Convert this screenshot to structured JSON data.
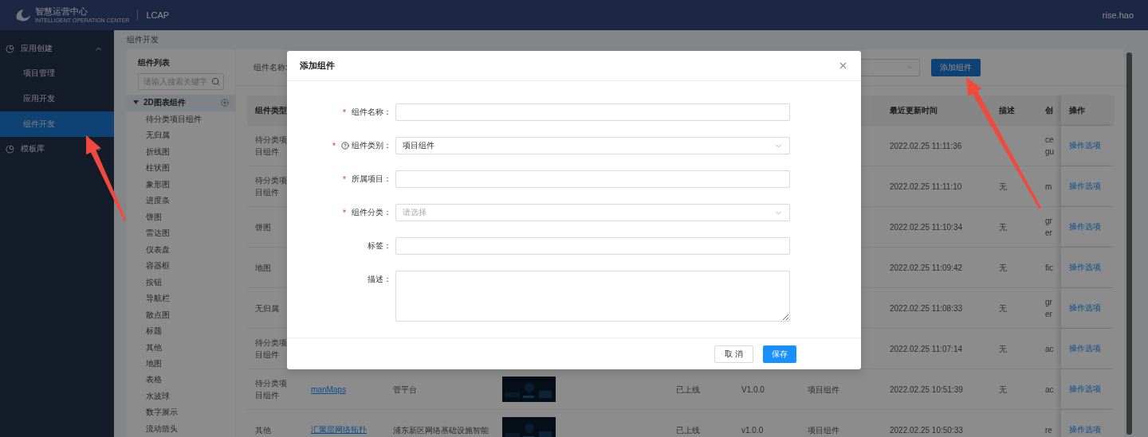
{
  "header": {
    "brand": "智慧运营中心",
    "brand_sub": "INTELLIGENT OPERATION CENTER",
    "app": "LCAP",
    "user": "rise.hao"
  },
  "sidebar": {
    "groups": [
      {
        "label": "应用创建",
        "expanded": true,
        "items": [
          {
            "label": "项目管理",
            "selected": false
          },
          {
            "label": "应用开发",
            "selected": false
          },
          {
            "label": "组件开发",
            "selected": true
          }
        ]
      },
      {
        "label": "模板库",
        "expanded": false
      }
    ]
  },
  "breadcrumb": "组件开发",
  "component_list": {
    "title": "组件列表",
    "search": {
      "placeholder": "请输入搜索关键字"
    },
    "tree": [
      {
        "label": "2D图表组件",
        "expanded": true,
        "selected": true,
        "children": [
          {
            "label": "待分类项目组件",
            "selected": false
          },
          {
            "label": "无归属",
            "selected": false
          },
          {
            "label": "折线图",
            "selected": false
          },
          {
            "label": "柱状图",
            "selected": false
          },
          {
            "label": "象形图",
            "selected": false
          },
          {
            "label": "进度条",
            "selected": false
          },
          {
            "label": "饼图",
            "selected": false
          },
          {
            "label": "雷达图",
            "selected": false
          },
          {
            "label": "仪表盘",
            "selected": false
          },
          {
            "label": "容器框",
            "selected": false
          },
          {
            "label": "按钮",
            "selected": false
          },
          {
            "label": "导航栏",
            "selected": false
          },
          {
            "label": "散点图",
            "selected": false
          },
          {
            "label": "标题",
            "selected": false
          },
          {
            "label": "其他",
            "selected": false
          },
          {
            "label": "地图",
            "selected": false
          },
          {
            "label": "表格",
            "selected": false
          },
          {
            "label": "水波球",
            "selected": false
          },
          {
            "label": "数字展示",
            "selected": false
          },
          {
            "label": "流动箭头",
            "selected": false
          }
        ]
      }
    ]
  },
  "filter": {
    "label": "组件名称:",
    "add_button": "添加组件"
  },
  "table": {
    "header": {
      "type": "组件类型",
      "updated": "最近更新时间",
      "description": "描述",
      "creator": "创",
      "action": "操作"
    },
    "rows": [
      {
        "type": "待分类项目组件",
        "updated": "2022.02.25 11:11:36",
        "creator": "ce gu",
        "action": "操作选项"
      },
      {
        "type": "待分类项目组件",
        "updated": "2022.02.25 11:11:10",
        "description": "无",
        "creator": "m",
        "action": "操作选项"
      },
      {
        "type": "饼图",
        "updated": "2022.02.25 11:10:34",
        "description": "无",
        "creator": "gr er",
        "action": "操作选项"
      },
      {
        "type": "地图",
        "updated": "2022.02.25 11:09:42",
        "description": "无",
        "creator": "fic",
        "action": "操作选项"
      },
      {
        "type": "无归属",
        "updated": "2022.02.25 11:08:33",
        "description": "无",
        "creator": "gr er",
        "action": "操作选项"
      },
      {
        "type": "待分类项目组件",
        "updated": "2022.02.25 11:07:14",
        "description": "无",
        "creator": "ac",
        "action": "操作选项"
      },
      {
        "type": "待分类项目组件",
        "name": "manMaps",
        "summary": "管平台",
        "status": "已上线",
        "version": "V1.0.0",
        "category": "项目组件",
        "updated": "2022.02.25 10:51:39",
        "description": "无",
        "creator": "ac",
        "action": "操作选项"
      },
      {
        "type": "其他",
        "name": "汇聚层网络拓扑",
        "summary": "浦东新区网络基础设施智能",
        "status": "已上线",
        "version": "v1.0.0",
        "category": "项目组件",
        "updated": "2022.02.25 10:50:33",
        "creator": "re",
        "action": "操作选项"
      }
    ]
  },
  "modal": {
    "title": "添加组件",
    "fields": [
      {
        "kind": "input",
        "label": "组件名称：",
        "mark": "*",
        "help": false
      },
      {
        "kind": "select",
        "label": "组件类别：",
        "mark": "*",
        "help": true,
        "value": "项目组件"
      },
      {
        "kind": "input",
        "label": "所属项目：",
        "mark": "*",
        "help": false
      },
      {
        "kind": "select",
        "label": "组件分类：",
        "mark": "*",
        "help": false,
        "placeholder": "请选择"
      },
      {
        "kind": "input",
        "label": "标签：",
        "help": false
      },
      {
        "kind": "textarea",
        "label": "描述：",
        "help": false
      }
    ],
    "cancel": "取 消",
    "save": "保存"
  }
}
